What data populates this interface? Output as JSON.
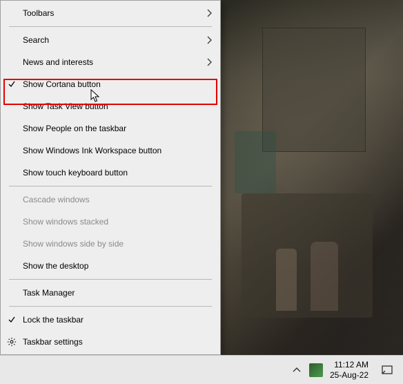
{
  "menu": {
    "toolbars": "Toolbars",
    "search": "Search",
    "news": "News and interests",
    "show_cortana": "Show Cortana button",
    "show_taskview": "Show Task View button",
    "show_people": "Show People on the taskbar",
    "show_ink": "Show Windows Ink Workspace button",
    "show_touch_kb": "Show touch keyboard button",
    "cascade": "Cascade windows",
    "stacked": "Show windows stacked",
    "sidebyside": "Show windows side by side",
    "show_desktop": "Show the desktop",
    "task_manager": "Task Manager",
    "lock_taskbar": "Lock the taskbar",
    "taskbar_settings": "Taskbar settings"
  },
  "taskbar": {
    "time": "11:12 AM",
    "date": "25-Aug-22"
  },
  "highlight": {
    "color": "#e30000"
  }
}
